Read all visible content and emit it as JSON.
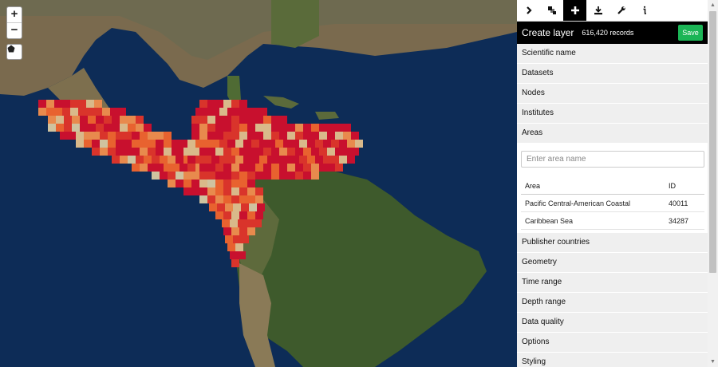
{
  "map": {
    "zoom_in_label": "+",
    "zoom_out_label": "−",
    "draw_tool_icon": "polygon-icon",
    "grid_colors": [
      "#c8102e",
      "#d9342b",
      "#e8622f",
      "#e88a4d",
      "#d9b98a",
      "#cfc39f"
    ]
  },
  "toolbar": {
    "tabs": [
      {
        "icon": "chevron-right-icon"
      },
      {
        "icon": "layers-icon"
      },
      {
        "icon": "plus-icon",
        "active": true
      },
      {
        "icon": "download-icon"
      },
      {
        "icon": "wrench-icon"
      },
      {
        "icon": "info-icon"
      }
    ]
  },
  "header": {
    "title": "Create layer",
    "record_count": "616,420 records",
    "save_label": "Save"
  },
  "sections": {
    "scientific_name": "Scientific name",
    "datasets": "Datasets",
    "nodes": "Nodes",
    "institutes": "Institutes",
    "areas": "Areas",
    "publisher_countries": "Publisher countries",
    "geometry": "Geometry",
    "time_range": "Time range",
    "depth_range": "Depth range",
    "data_quality": "Data quality",
    "options": "Options",
    "styling": "Styling"
  },
  "areas": {
    "placeholder": "Enter area name",
    "columns": [
      "Area",
      "ID"
    ],
    "rows": [
      {
        "area": "Pacific Central-American Coastal",
        "id": "40011"
      },
      {
        "area": "Caribbean Sea",
        "id": "34287"
      }
    ]
  }
}
